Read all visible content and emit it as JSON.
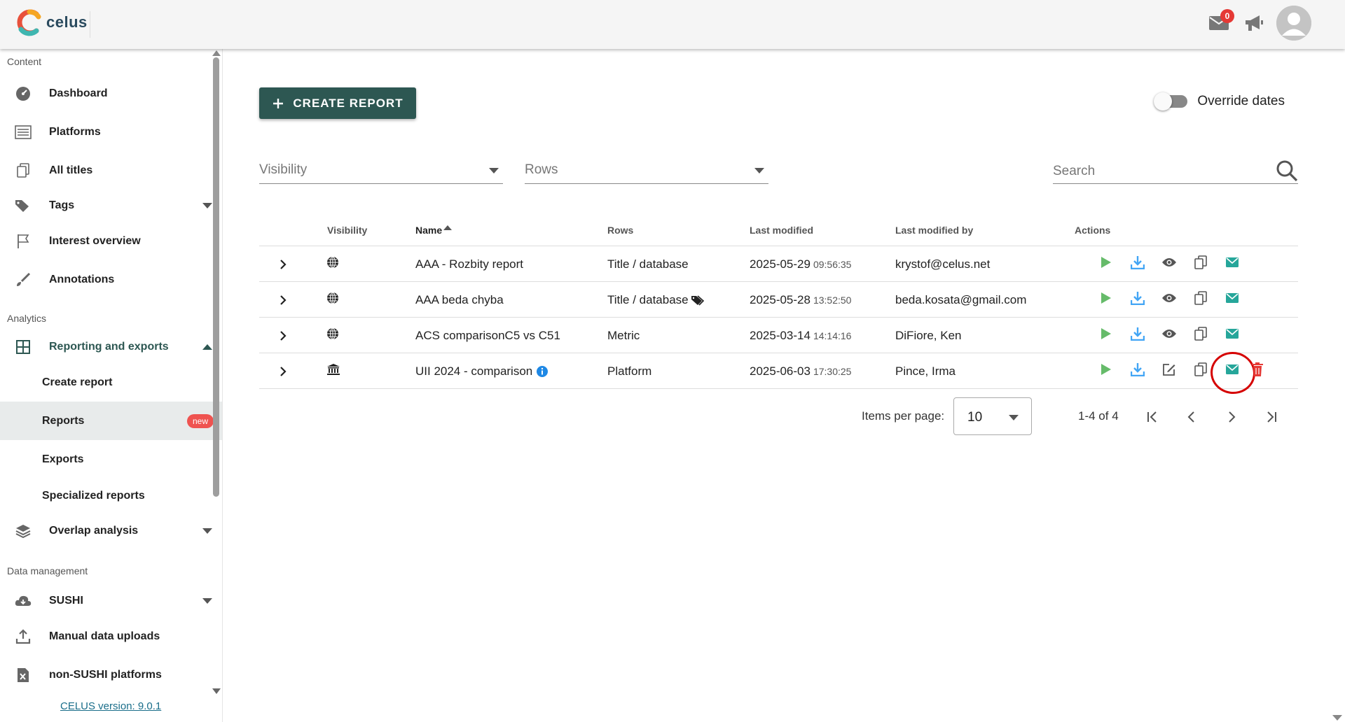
{
  "topbar": {
    "logo_text": "celus",
    "notification_count": "0"
  },
  "sidebar": {
    "sections": {
      "content": "Content",
      "analytics": "Analytics",
      "data_management": "Data management"
    },
    "items": {
      "dashboard": "Dashboard",
      "platforms": "Platforms",
      "all_titles": "All titles",
      "tags": "Tags",
      "interest_overview": "Interest overview",
      "annotations": "Annotations",
      "reporting": "Reporting and exports",
      "create_report": "Create report",
      "reports": "Reports",
      "reports_badge": "new",
      "exports": "Exports",
      "specialized_reports": "Specialized reports",
      "overlap_analysis": "Overlap analysis",
      "sushi": "SUSHI",
      "manual_uploads": "Manual data uploads",
      "non_sushi": "non-SUSHI platforms"
    },
    "version": "CELUS version: 9.0.1"
  },
  "main": {
    "create_button": "CREATE REPORT",
    "override_label": "Override dates",
    "override_on": false,
    "filters": {
      "visibility_placeholder": "Visibility",
      "rows_placeholder": "Rows",
      "search_placeholder": "Search"
    }
  },
  "table": {
    "headers": {
      "visibility": "Visibility",
      "name": "Name",
      "rows": "Rows",
      "last_modified": "Last modified",
      "last_modified_by": "Last modified by",
      "actions": "Actions"
    },
    "rows": [
      {
        "visibility_icon": "globe-icon",
        "name": "AAA - Rozbity report",
        "rows": "Title / database",
        "date": "2025-05-29",
        "time": "09:56:35",
        "by": "krystof@celus.net"
      },
      {
        "visibility_icon": "globe-icon",
        "name": "AAA beda chyba",
        "rows": "Title / database",
        "date": "2025-05-28",
        "time": "13:52:50",
        "by": "beda.kosata@gmail.com"
      },
      {
        "visibility_icon": "globe-icon",
        "name": "ACS comparisonC5 vs C51",
        "rows": "Metric",
        "date": "2025-03-14",
        "time": "14:14:16",
        "by": "DiFiore, Ken"
      },
      {
        "visibility_icon": "institution-icon",
        "name": "UII 2024 - comparison",
        "rows": "Platform",
        "date": "2025-06-03",
        "time": "17:30:25",
        "by": "Pince, Irma"
      }
    ]
  },
  "pagination": {
    "items_per_page_label": "Items per page:",
    "items_per_page": "10",
    "range": "1-4 of 4"
  },
  "colors": {
    "primary": "#2d5752",
    "play": "#66bb6a",
    "download": "#42a5f5",
    "email": "#26a69a",
    "delete": "#e53935",
    "info": "#1e88e5",
    "highlight": "#d50000"
  }
}
